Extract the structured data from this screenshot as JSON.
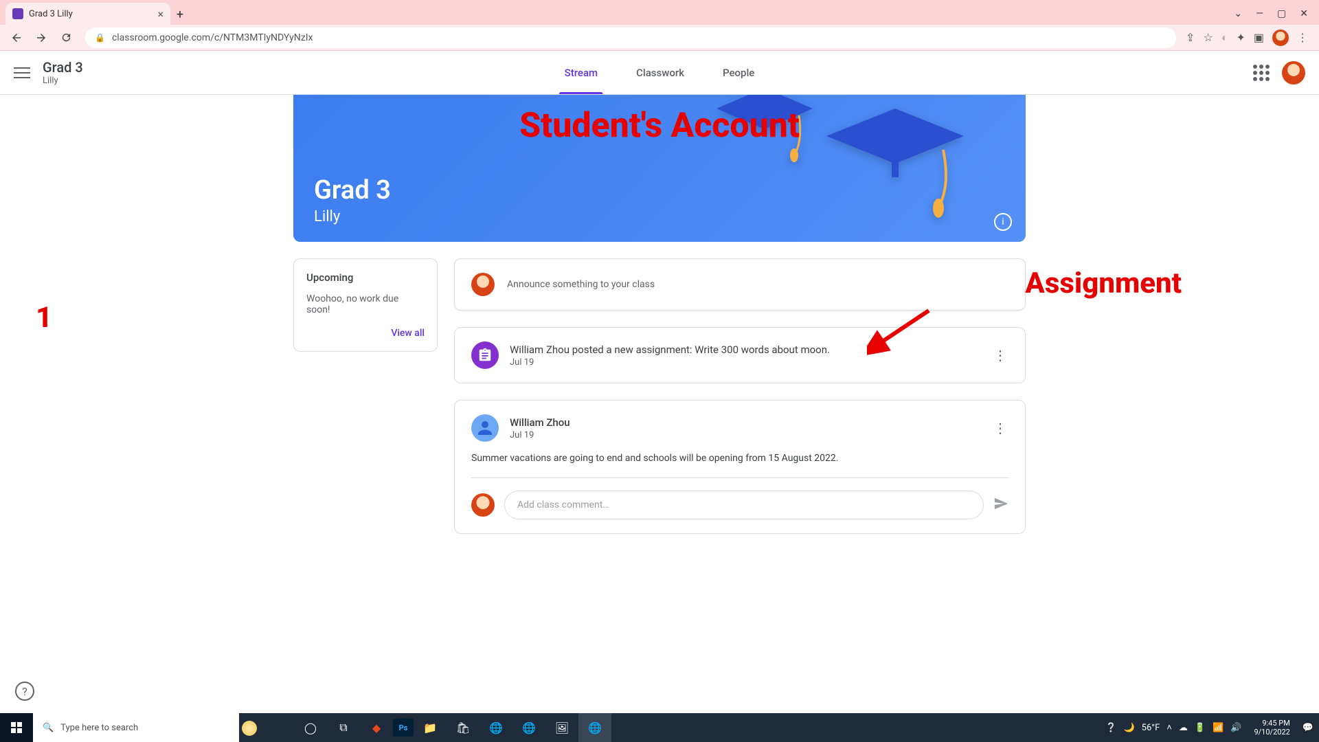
{
  "browser": {
    "tab_title": "Grad 3 Lilly",
    "url": "classroom.google.com/c/NTM3MTIyNDYyNzIx",
    "window_controls": {
      "min": "—",
      "max": "▢",
      "close": "✕",
      "chevron": "⌄"
    }
  },
  "header": {
    "class_name": "Grad 3",
    "section": "Lilly",
    "tabs": {
      "stream": "Stream",
      "classwork": "Classwork",
      "people": "People"
    }
  },
  "banner": {
    "title": "Grad 3",
    "subtitle": "Lilly"
  },
  "upcoming": {
    "heading": "Upcoming",
    "message": "Woohoo, no work due soon!",
    "viewall": "View all"
  },
  "announce": {
    "placeholder": "Announce something to your class"
  },
  "assignment_post": {
    "title": "William Zhou posted a new assignment: Write 300 words about moon.",
    "date": "Jul 19"
  },
  "announcement_post": {
    "author": "William Zhou",
    "date": "Jul 19",
    "body": "Summer vacations are going to end and schools will be opening from 15 August 2022.",
    "comment_placeholder": "Add class comment…"
  },
  "annotations": {
    "top": "Student's Account",
    "right": "Assignment",
    "left_num": "1"
  },
  "taskbar": {
    "search_placeholder": "Type here to search",
    "weather": "56°F",
    "time": "9:45 PM",
    "date": "9/10/2022"
  }
}
